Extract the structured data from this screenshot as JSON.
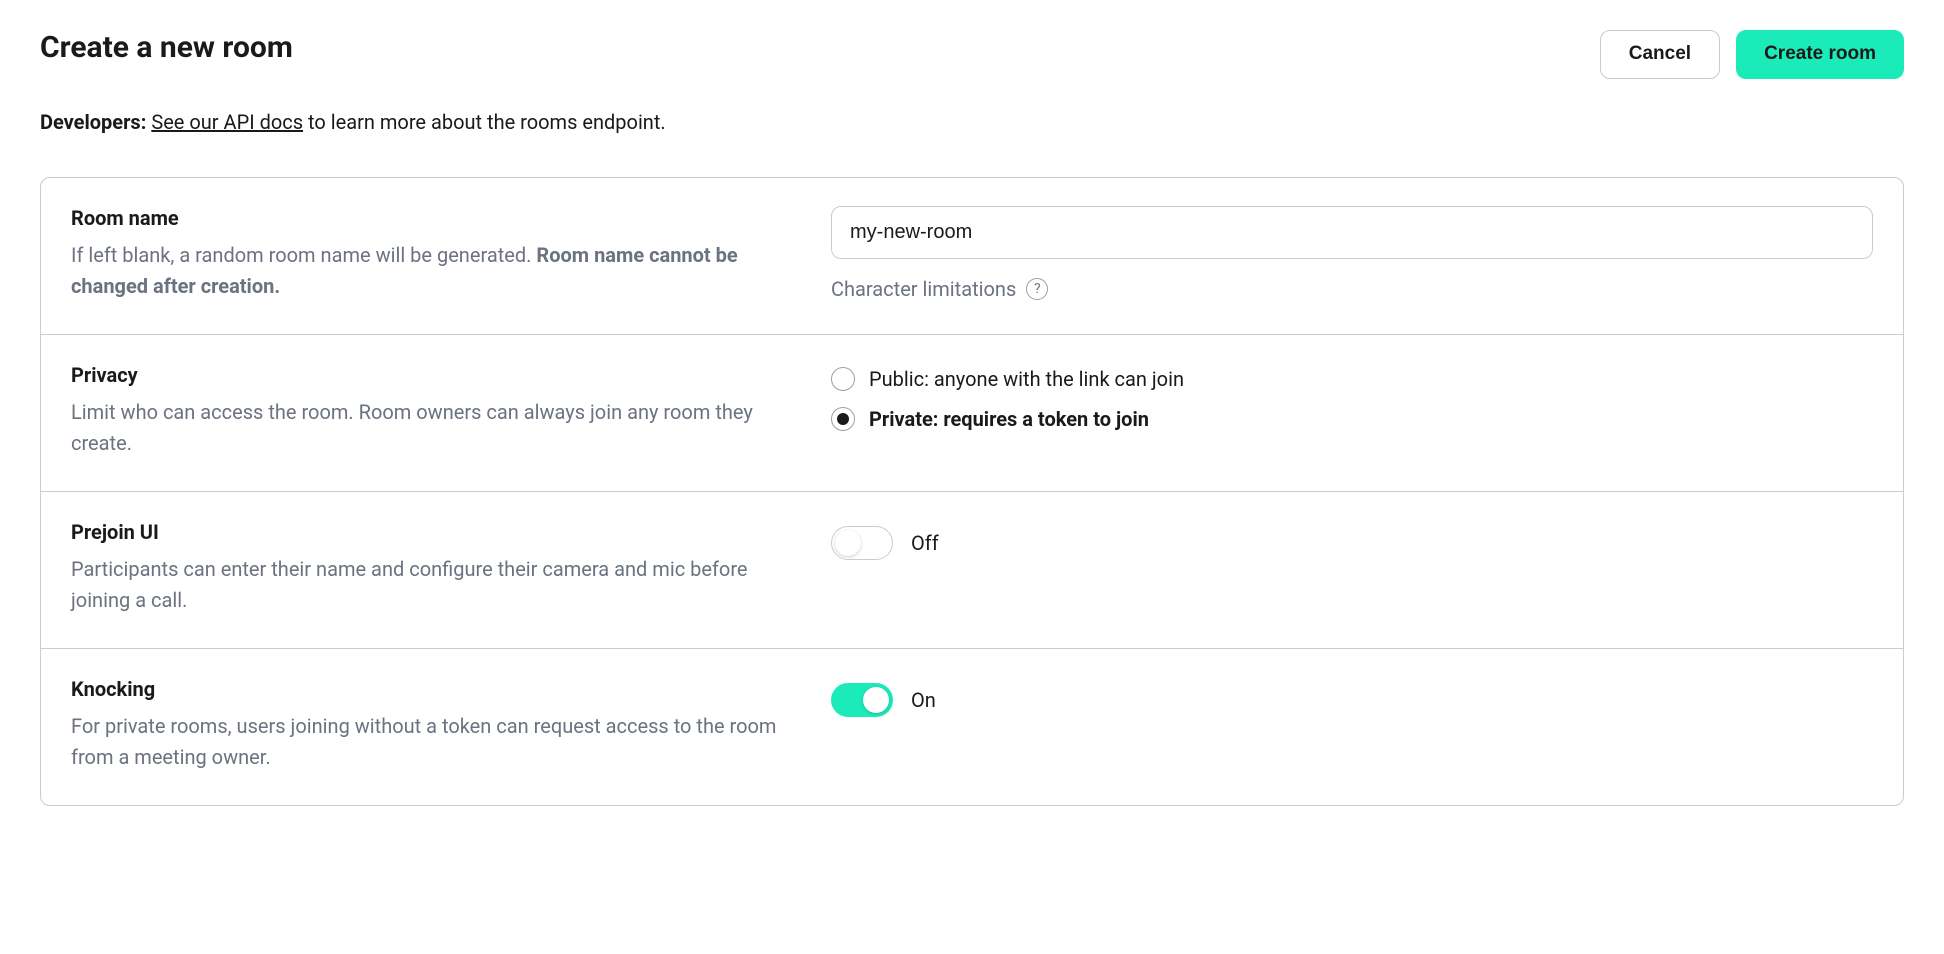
{
  "header": {
    "title": "Create a new room",
    "cancel_label": "Cancel",
    "create_label": "Create room"
  },
  "dev_note": {
    "prefix": "Developers:",
    "link_text": "See our API docs",
    "suffix": " to learn more about the rooms endpoint."
  },
  "room_name": {
    "label": "Room name",
    "desc_prefix": "If left blank, a random room name will be generated. ",
    "desc_emph": "Room name cannot be changed after creation.",
    "value": "my-new-room",
    "char_limit_text": "Character limitations"
  },
  "privacy": {
    "label": "Privacy",
    "desc": "Limit who can access the room. Room owners can always join any room they create.",
    "option_public": "Public: anyone with the link can join",
    "option_private": "Private: requires a token to join",
    "selected": "private"
  },
  "prejoin": {
    "label": "Prejoin UI",
    "desc": "Participants can enter their name and configure their camera and mic before joining a call.",
    "state_label": "Off",
    "enabled": false
  },
  "knocking": {
    "label": "Knocking",
    "desc": "For private rooms, users joining without a token can request access to the room from a meeting owner.",
    "state_label": "On",
    "enabled": true
  }
}
